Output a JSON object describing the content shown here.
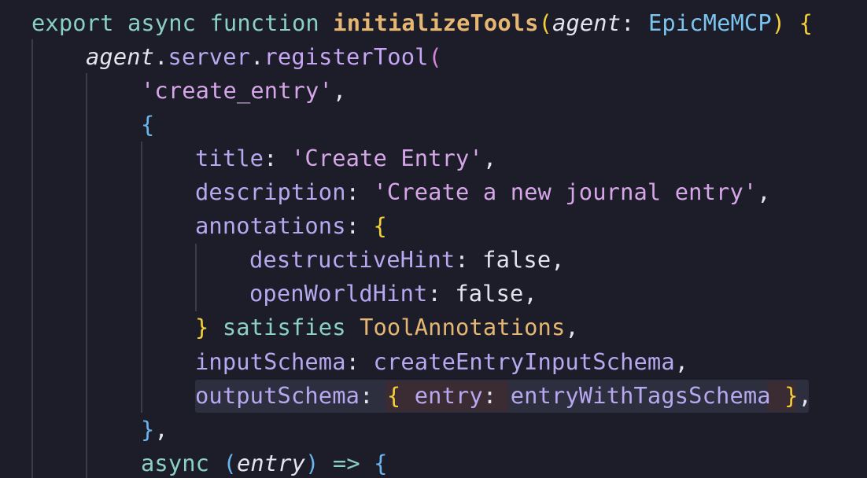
{
  "code": {
    "line1": {
      "export": "export",
      "async": "async",
      "function": "function",
      "name": "initializeTools",
      "open_paren": "(",
      "param": "agent",
      "colon": ":",
      "type": "EpicMeMCP",
      "close_paren": ")",
      "open_brace": "{"
    },
    "line2": {
      "obj": "agent",
      "dot1": ".",
      "server": "server",
      "dot2": ".",
      "method": "registerTool",
      "open_paren": "("
    },
    "line3": {
      "string": "'create_entry'",
      "comma": ","
    },
    "line4": {
      "open_brace": "{"
    },
    "line5": {
      "key": "title",
      "colon": ":",
      "value": "'Create Entry'",
      "comma": ","
    },
    "line6": {
      "key": "description",
      "colon": ":",
      "value": "'Create a new journal entry'",
      "comma": ","
    },
    "line7": {
      "key": "annotations",
      "colon": ":",
      "open_brace": "{"
    },
    "line8": {
      "key": "destructiveHint",
      "colon": ":",
      "value": "false",
      "comma": ","
    },
    "line9": {
      "key": "openWorldHint",
      "colon": ":",
      "value": "false",
      "comma": ","
    },
    "line10": {
      "close_brace": "}",
      "satisfies": "satisfies",
      "type": "ToolAnnotations",
      "comma": ","
    },
    "line11": {
      "key": "inputSchema",
      "colon": ":",
      "value": "createEntryInputSchema",
      "comma": ","
    },
    "line12": {
      "key": "outputSchema",
      "colon": ":",
      "open_brace": "{",
      "inner_key": "entry",
      "inner_colon": ":",
      "inner_value": "entryWithTagsSchema",
      "close_brace": "}",
      "comma": ","
    },
    "line13": {
      "close_brace": "}",
      "comma": ","
    },
    "line14": {
      "async": "async",
      "open_paren": "(",
      "param": "entry",
      "close_paren": ")",
      "arrow": "=>",
      "open_brace": "{"
    }
  },
  "colors": {
    "background": "#1c1d29",
    "keyword": "#8ad0c4",
    "function_name": "#e6b673",
    "property": "#b7a8ef",
    "string": "#d6a6e8",
    "bracket_level1": "#f4cf3a",
    "bracket_level2": "#d684d8",
    "bracket_level3": "#6ab4f0"
  }
}
